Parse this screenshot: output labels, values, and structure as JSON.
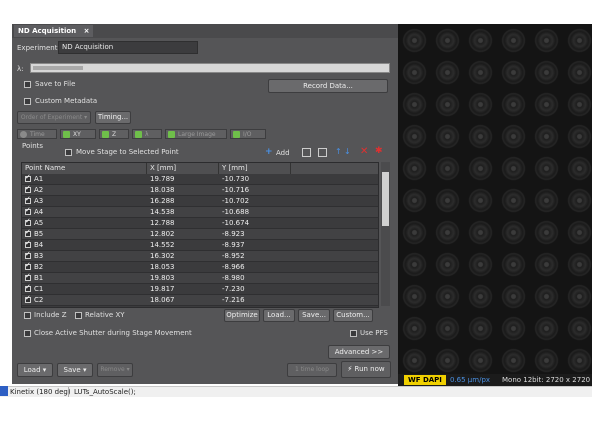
{
  "window": {
    "tab_title": "ND Acquisition",
    "tab_close": "×"
  },
  "experiment": {
    "label": "Experiment:",
    "value": "ND Acquisition"
  },
  "lambda_label": "λ:",
  "options": {
    "save_to_file": "Save to File",
    "custom_metadata": "Custom Metadata",
    "record_data": "Record Data...",
    "order_of_experiment": "Order of Experiment",
    "timing": "Timing..."
  },
  "section_tabs": [
    {
      "label": "Time",
      "checked": false,
      "icon": "clock-icon"
    },
    {
      "label": "XY",
      "checked": false,
      "icon": "grid-icon"
    },
    {
      "label": "Z",
      "checked": true,
      "icon": "stack-icon"
    },
    {
      "label": "λ",
      "checked": false,
      "icon": "wavelength-icon"
    },
    {
      "label": "Large Image",
      "checked": false,
      "icon": "large-image-icon"
    },
    {
      "label": "I/O",
      "checked": false,
      "icon": "io-icon"
    }
  ],
  "points": {
    "title": "Points",
    "move_stage": "Move Stage to Selected Point",
    "add": "Add",
    "columns": [
      "Point Name",
      "X [mm]",
      "Y [mm]"
    ],
    "rows": [
      {
        "name": "A1",
        "x": "19.789",
        "y": "-10.730"
      },
      {
        "name": "A2",
        "x": "18.038",
        "y": "-10.716"
      },
      {
        "name": "A3",
        "x": "16.288",
        "y": "-10.702"
      },
      {
        "name": "A4",
        "x": "14.538",
        "y": "-10.688"
      },
      {
        "name": "A5",
        "x": "12.788",
        "y": "-10.674"
      },
      {
        "name": "B5",
        "x": "12.802",
        "y": "-8.923"
      },
      {
        "name": "B4",
        "x": "14.552",
        "y": "-8.937"
      },
      {
        "name": "B3",
        "x": "16.302",
        "y": "-8.952"
      },
      {
        "name": "B2",
        "x": "18.053",
        "y": "-8.966"
      },
      {
        "name": "B1",
        "x": "19.803",
        "y": "-8.980"
      },
      {
        "name": "C1",
        "x": "19.817",
        "y": "-7.230"
      },
      {
        "name": "C2",
        "x": "18.067",
        "y": "-7.216"
      }
    ],
    "include_z": "Include Z",
    "relative_xy": "Relative XY",
    "optimize": "Optimize",
    "load": "Load...",
    "save": "Save...",
    "custom": "Custom...",
    "close_shutter": "Close Active Shutter during Stage Movement",
    "use_pfs": "Use PFS",
    "advanced": "Advanced >>"
  },
  "bottom": {
    "load": "Load",
    "save": "Save",
    "remove": "Remove",
    "one_time_loop": "1 time loop",
    "run_now": "Run now"
  },
  "image_info": {
    "channel": "WF DAPI",
    "scale": "0.65 µm/px",
    "mono": "Mono 12bit: 2720 x 2720 px"
  },
  "status": {
    "camera": "Kinetix (180 deg)",
    "macro": "LUTs_AutoScale();"
  },
  "colors": {
    "panel": "#555557",
    "accent_blue": "#4a90e2",
    "delete_red": "#e03030",
    "channel_yellow": "#f0d000"
  }
}
